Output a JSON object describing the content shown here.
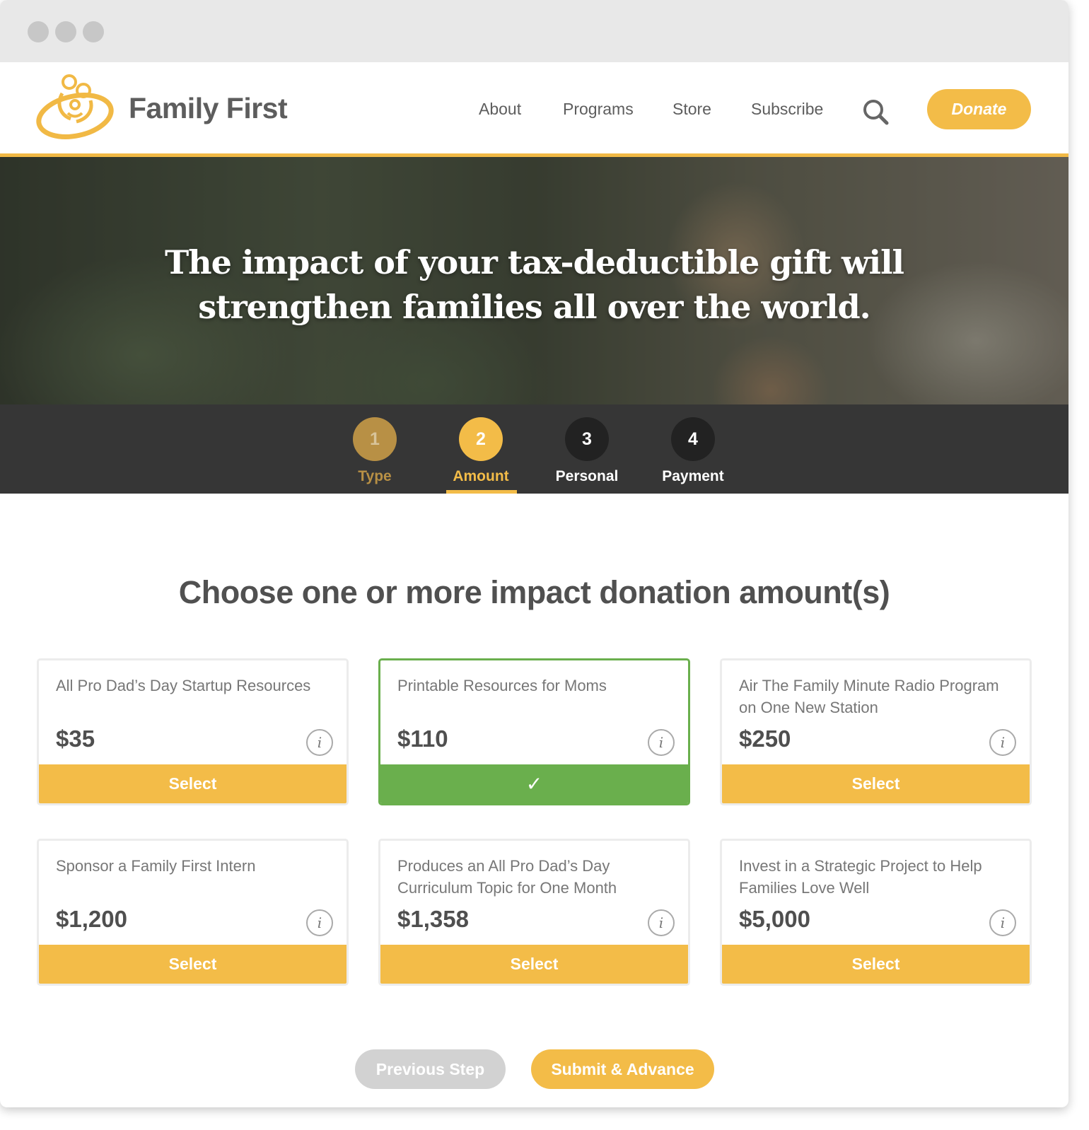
{
  "window": {
    "controls": [
      "close",
      "minimize",
      "zoom"
    ]
  },
  "header": {
    "brand": "Family First",
    "logo_icon": "family-logo-icon",
    "nav": [
      {
        "label": "About"
      },
      {
        "label": "Programs"
      },
      {
        "label": "Store"
      },
      {
        "label": "Subscribe"
      }
    ],
    "search_icon": "search-icon",
    "donate_label": "Donate"
  },
  "hero": {
    "line1": "The impact of your tax-deductible gift will",
    "line2": "strengthen families all over the world."
  },
  "steps": [
    {
      "number": "1",
      "label": "Type",
      "state": "completed"
    },
    {
      "number": "2",
      "label": "Amount",
      "state": "active"
    },
    {
      "number": "3",
      "label": "Personal",
      "state": "pending"
    },
    {
      "number": "4",
      "label": "Payment",
      "state": "pending"
    }
  ],
  "main": {
    "title": "Choose one or more impact donation amount(s)",
    "info_glyph": "i",
    "cards": [
      {
        "name": "All Pro Dad’s Day Startup Resources",
        "amount": "$35",
        "action": "Select",
        "selected": false
      },
      {
        "name": "Printable Resources for Moms",
        "amount": "$110",
        "action": "✓",
        "selected": true
      },
      {
        "name": "Air The Family Minute Radio Program on One New Station",
        "amount": "$250",
        "action": "Select",
        "selected": false
      },
      {
        "name": "Sponsor a Family First Intern",
        "amount": "$1,200",
        "action": "Select",
        "selected": false
      },
      {
        "name": "Produces an All Pro Dad’s Day Curriculum Topic for One Month",
        "amount": "$1,358",
        "action": "Select",
        "selected": false
      },
      {
        "name": "Invest in a Strategic Project to Help Families Love Well",
        "amount": "$5,000",
        "action": "Select",
        "selected": false
      }
    ]
  },
  "footer_buttons": {
    "previous": "Previous Step",
    "submit": "Submit & Advance"
  },
  "colors": {
    "accent": "#f3bc48",
    "selected": "#6aaf4d",
    "step_bar": "#363636"
  }
}
